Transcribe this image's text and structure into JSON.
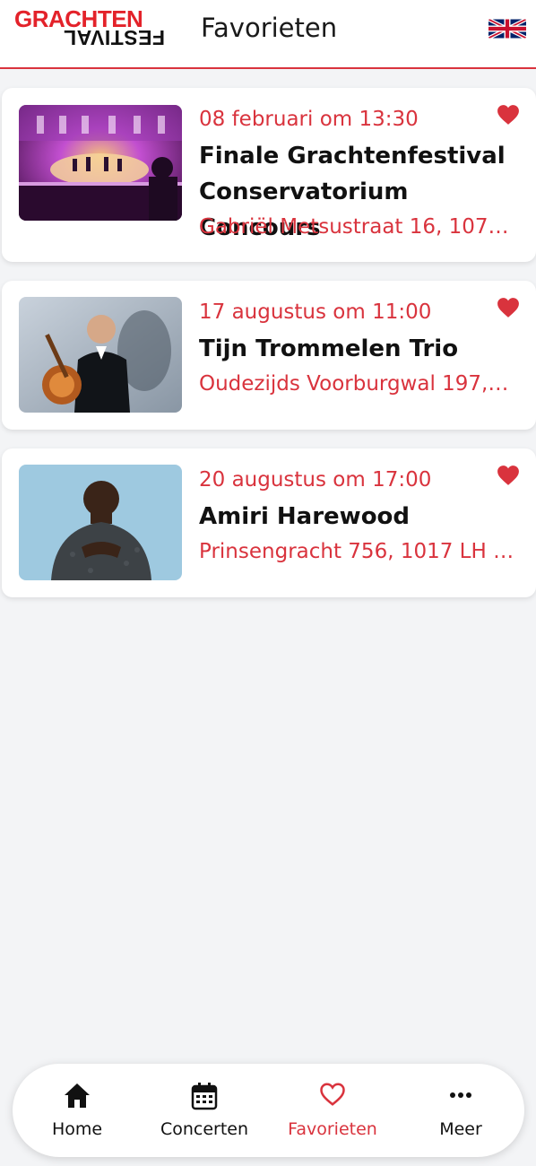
{
  "header": {
    "logo_top": "GRACHTEN",
    "logo_bottom": "FESTIVAL",
    "title": "Favorieten",
    "language_icon": "uk-flag-icon"
  },
  "colors": {
    "accent": "#d9333d",
    "background": "#f3f4f6",
    "card": "#ffffff",
    "text": "#111111"
  },
  "favorites": [
    {
      "date": "08 februari om 13:30",
      "title": "Finale Grachtenfestival Conservatorium Concours",
      "address": "Gabriël Metsustraat 16, 107…",
      "favorited": true,
      "image": "concert-hall-photo"
    },
    {
      "date": "17 augustus om 11:00",
      "title": "Tijn Trommelen Trio",
      "address": "Oudezijds Voorburgwal 197,…",
      "favorited": true,
      "image": "guitarist-portrait-photo"
    },
    {
      "date": "20 augustus om 17:00",
      "title": "Amiri Harewood",
      "address": "Prinsengracht 756, 1017 LH …",
      "favorited": true,
      "image": "artist-portrait-photo"
    }
  ],
  "nav": {
    "items": [
      {
        "label": "Home",
        "icon": "home-icon"
      },
      {
        "label": "Concerten",
        "icon": "calendar-icon"
      },
      {
        "label": "Favorieten",
        "icon": "heart-outline-icon",
        "active": true
      },
      {
        "label": "Meer",
        "icon": "more-icon"
      }
    ]
  }
}
